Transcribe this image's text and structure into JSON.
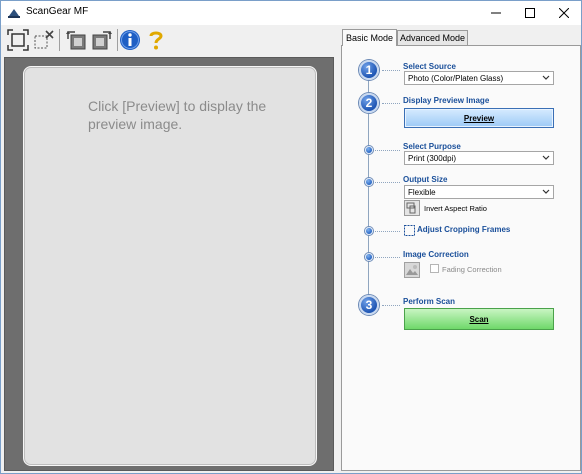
{
  "window": {
    "title": "ScanGear MF",
    "controls": [
      "minimize",
      "maximize",
      "close"
    ]
  },
  "toolbar": {
    "buttons": [
      {
        "icon": "auto-crop-icon"
      },
      {
        "icon": "remove-crop-icon"
      },
      {
        "icon": "rotate-left-icon"
      },
      {
        "icon": "rotate-right-icon"
      },
      {
        "icon": "info-icon"
      },
      {
        "icon": "help-icon"
      }
    ]
  },
  "preview": {
    "hint": "Click [Preview] to display the preview image."
  },
  "tabs": [
    {
      "label": "Basic Mode",
      "active": true
    },
    {
      "label": "Advanced Mode",
      "active": false
    }
  ],
  "steps": {
    "step1_number": "1",
    "step2_number": "2",
    "step3_number": "3"
  },
  "basic": {
    "select_source_label": "Select Source",
    "select_source_value": "Photo (Color/Platen Glass)",
    "display_preview_label": "Display Preview Image",
    "preview_button": "Preview",
    "select_purpose_label": "Select Purpose",
    "select_purpose_value": "Print (300dpi)",
    "output_size_label": "Output Size",
    "output_size_value": "Flexible",
    "invert_aspect_label": "Invert Aspect Ratio",
    "adjust_cropping_label": "Adjust Cropping Frames",
    "image_correction_label": "Image Correction",
    "fading_correction_label": "Fading Correction",
    "fading_correction_checked": false,
    "perform_scan_label": "Perform Scan",
    "scan_button": "Scan"
  },
  "colors": {
    "accent_blue": "#1a4f9a",
    "preview_button": "#9dcaf6",
    "scan_button": "#6fd86a"
  }
}
